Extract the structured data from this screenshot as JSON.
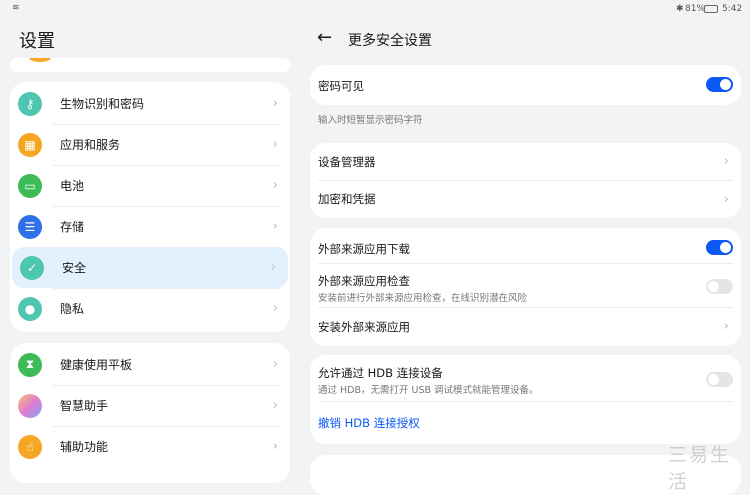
{
  "status": {
    "battery": "81%",
    "time": "5:42"
  },
  "left": {
    "title": "设置",
    "groups": [
      [
        {
          "label": "生物识别和密码",
          "icon": "key-icon",
          "color": "#4fc6b0"
        },
        {
          "label": "应用和服务",
          "icon": "apps-icon",
          "color": "#f5a623"
        },
        {
          "label": "电池",
          "icon": "battery-icon",
          "color": "#3dbb56"
        },
        {
          "label": "存储",
          "icon": "storage-icon",
          "color": "#2f6fe8"
        },
        {
          "label": "安全",
          "icon": "shield-icon",
          "color": "#4fc6b0"
        },
        {
          "label": "隐私",
          "icon": "privacy-icon",
          "color": "#4fc6b0"
        }
      ],
      [
        {
          "label": "健康使用平板",
          "icon": "hourglass-icon",
          "color": "#3dbb56"
        },
        {
          "label": "智慧助手",
          "icon": "assistant-icon",
          "color": "#c48ae8"
        },
        {
          "label": "辅助功能",
          "icon": "accessibility-icon",
          "color": "#f5a623"
        }
      ]
    ]
  },
  "right": {
    "title": "更多安全设置",
    "password_visible": {
      "label": "密码可见",
      "on": true,
      "caption": "输入时短暂显示密码字符"
    },
    "device_admin": "设备管理器",
    "encryption": "加密和凭据",
    "ext_download": {
      "label": "外部来源应用下载",
      "on": true
    },
    "ext_check": {
      "label": "外部来源应用检查",
      "sub": "安装前进行外部来源应用检查，在线识别潜在风险",
      "on": false
    },
    "ext_install": "安装外部来源应用",
    "hdb": {
      "label": "允许通过 HDB 连接设备",
      "sub": "通过 HDB，无需打开 USB 调试模式就能管理设备。",
      "on": false
    },
    "hdb_revoke": "撤销 HDB 连接授权"
  },
  "watermark": "三易生活"
}
